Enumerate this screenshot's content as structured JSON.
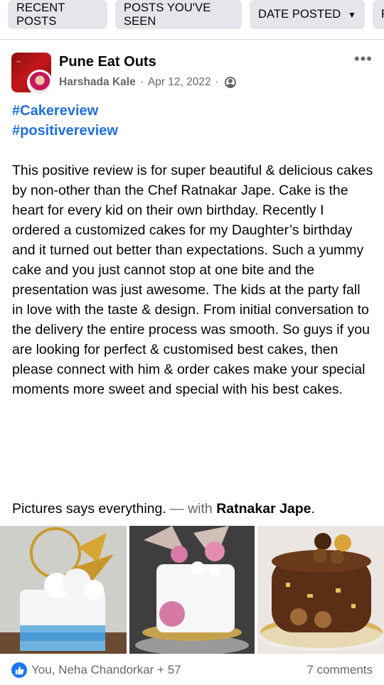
{
  "filters": {
    "recent": "RECENT POSTS",
    "seen": "POSTS YOU'VE SEEN",
    "date": "DATE POSTED",
    "more": "F"
  },
  "post": {
    "group_name": "Pune Eat Outs",
    "author": "Harshada Kale",
    "date": "Apr 12, 2022",
    "separator": "·",
    "hashtags": [
      "#Cakereview",
      "#positivereview"
    ],
    "body": "This positive review is for super beautiful & delicious cakes by non-other than the Chef Ratnakar Jape. Cake is the heart for every kid on their own birthday. Recently I ordered a customized cakes for my Daughter’s birthday and it turned out better than expectations. Such a yummy cake and you just cannot stop at one bite and the presentation was just awesome. The kids at the party fall in love with the taste & design. From initial conversation to the delivery the entire process was smooth. So guys if you are looking for perfect & customised best cakes, then please connect with him & order cakes make your special moments more sweet and special with his best cakes.",
    "caption_text": "Pictures says everything.",
    "caption_with": " — with ",
    "tagged_person": "Ratnakar Jape",
    "caption_end": ".",
    "reactions": "You, Neha Chandorkar + 57",
    "comments": "7 comments"
  },
  "colors": {
    "link_blue": "#216fdb",
    "like_blue": "#1877f2",
    "secondary_text": "#65676b",
    "chip_bg": "#e4e6eb"
  },
  "icons": {
    "dropdown": "caret-down-icon",
    "privacy": "members-icon",
    "more": "more-options-icon",
    "like": "like-icon"
  }
}
